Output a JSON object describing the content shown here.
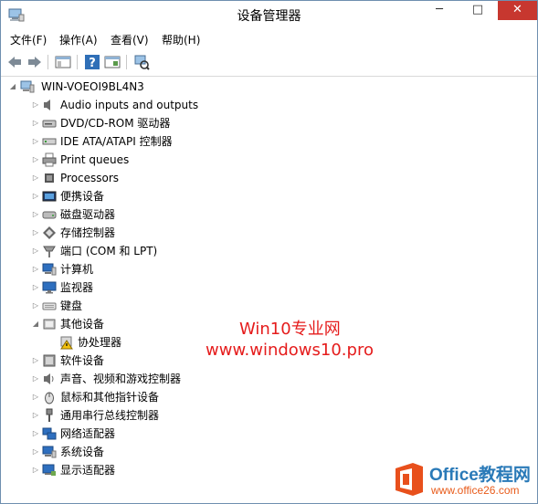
{
  "window": {
    "title": "设备管理器"
  },
  "menu": [
    "文件(F)",
    "操作(A)",
    "查看(V)",
    "帮助(H)"
  ],
  "tree": {
    "root": "WIN-VOEOI9BL4N3",
    "items": [
      {
        "label": "Audio inputs and outputs",
        "icon": "speaker-icon"
      },
      {
        "label": "DVD/CD-ROM 驱动器",
        "icon": "dvd-drive-icon"
      },
      {
        "label": "IDE ATA/ATAPI 控制器",
        "icon": "ide-controller-icon"
      },
      {
        "label": "Print queues",
        "icon": "printer-icon"
      },
      {
        "label": "Processors",
        "icon": "processor-icon"
      },
      {
        "label": "便携设备",
        "icon": "portable-device-icon"
      },
      {
        "label": "磁盘驱动器",
        "icon": "disk-drive-icon"
      },
      {
        "label": "存储控制器",
        "icon": "storage-controller-icon"
      },
      {
        "label": "端口 (COM 和 LPT)",
        "icon": "port-icon"
      },
      {
        "label": "计算机",
        "icon": "computer-icon"
      },
      {
        "label": "监视器",
        "icon": "monitor-icon"
      },
      {
        "label": "键盘",
        "icon": "keyboard-icon"
      },
      {
        "label": "其他设备",
        "icon": "other-devices-icon",
        "expanded": true
      },
      {
        "label": "协处理器",
        "icon": "warning-device-icon",
        "child": true
      },
      {
        "label": "软件设备",
        "icon": "software-device-icon"
      },
      {
        "label": "声音、视频和游戏控制器",
        "icon": "sound-icon"
      },
      {
        "label": "鼠标和其他指针设备",
        "icon": "mouse-icon"
      },
      {
        "label": "通用串行总线控制器",
        "icon": "usb-icon"
      },
      {
        "label": "网络适配器",
        "icon": "network-adapter-icon"
      },
      {
        "label": "系统设备",
        "icon": "system-device-icon"
      },
      {
        "label": "显示适配器",
        "icon": "display-adapter-icon"
      }
    ]
  },
  "watermark": {
    "line1": "Win10专业网",
    "line2": "www.windows10.pro"
  },
  "badge": {
    "title": "Office教程网",
    "url": "www.office26.com"
  },
  "colors": {
    "close": "#c7372f",
    "watermark": "#e51c1c",
    "badge_blue": "#2a7ab8",
    "badge_orange": "#e85b1a"
  }
}
